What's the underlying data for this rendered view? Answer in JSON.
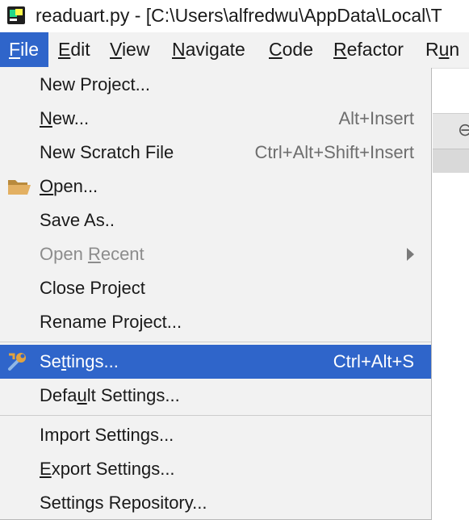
{
  "window": {
    "title": "readuart.py - [C:\\Users\\alfredwu\\AppData\\Local\\T"
  },
  "menubar": {
    "items": [
      {
        "pre": "",
        "u": "F",
        "post": "ile"
      },
      {
        "pre": "",
        "u": "E",
        "post": "dit"
      },
      {
        "pre": "",
        "u": "V",
        "post": "iew"
      },
      {
        "pre": "",
        "u": "N",
        "post": "avigate"
      },
      {
        "pre": "",
        "u": "C",
        "post": "ode"
      },
      {
        "pre": "",
        "u": "R",
        "post": "efactor"
      },
      {
        "pre": "R",
        "u": "u",
        "post": "n"
      }
    ]
  },
  "file_menu": {
    "new_project": {
      "pre": "New Pro",
      "u": "j",
      "post": "ect..."
    },
    "new": {
      "pre": "",
      "u": "N",
      "post": "ew...",
      "shortcut": "Alt+Insert"
    },
    "new_scratch": {
      "label": "New Scratch File",
      "shortcut": "Ctrl+Alt+Shift+Insert"
    },
    "open": {
      "pre": "",
      "u": "O",
      "post": "pen..."
    },
    "save_as": {
      "label": "Save As.."
    },
    "open_recent": {
      "pre": "Open ",
      "u": "R",
      "post": "ecent"
    },
    "close_project": {
      "pre": "Close Pro",
      "u": "j",
      "post": "ect"
    },
    "rename_project": {
      "label": "Rename Project..."
    },
    "settings": {
      "pre": "Se",
      "u": "t",
      "post": "tings...",
      "shortcut": "Ctrl+Alt+S"
    },
    "default_settings": {
      "pre": "Defa",
      "u": "u",
      "post": "lt Settings..."
    },
    "import_settings": {
      "label": "Import Settings..."
    },
    "export_settings": {
      "pre": "",
      "u": "E",
      "post": "xport Settings..."
    },
    "settings_repository": {
      "label": "Settings Repository..."
    }
  },
  "colors": {
    "accent": "#2f65ca",
    "menu_bg": "#f2f2f2",
    "disabled_text": "#8c8c8c"
  },
  "icons": {
    "folder": "open-folder-icon",
    "settings": "wrench-icon",
    "submenu": "chevron-right-icon"
  }
}
